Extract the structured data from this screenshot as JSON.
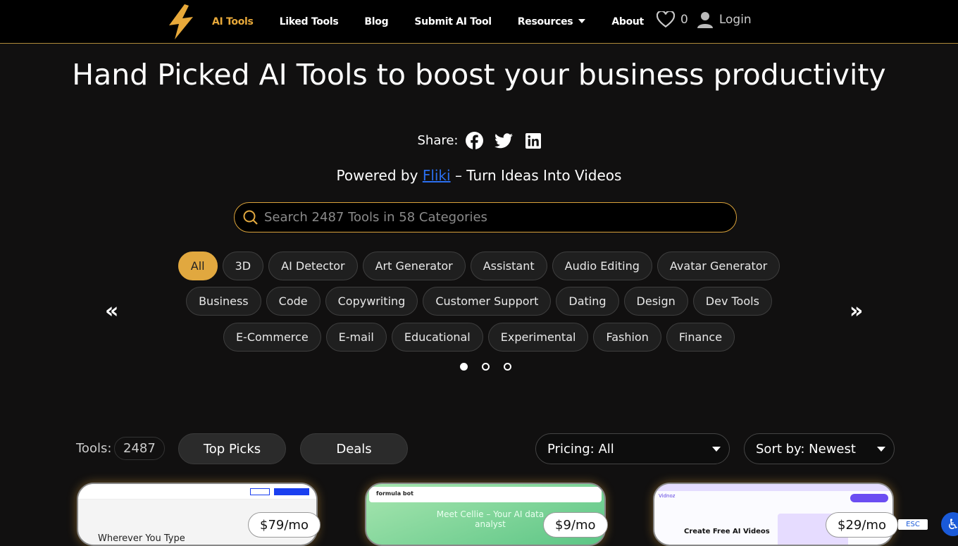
{
  "nav": {
    "links": [
      "AI Tools",
      "Liked Tools",
      "Blog",
      "Submit AI Tool",
      "Resources",
      "About"
    ],
    "liked_count": "0",
    "login": "Login"
  },
  "hero": {
    "title": "Hand Picked AI Tools to boost your business productivity",
    "share": "Share:",
    "powered_prefix": "Powered by",
    "powered_link": "Fliki",
    "powered_suffix": "– Turn Ideas Into Videos"
  },
  "search": {
    "placeholder": "Search 2487 Tools in 58 Categories"
  },
  "categories": [
    [
      "All",
      "3D",
      "AI Detector",
      "Art Generator",
      "Assistant",
      "Audio Editing",
      "Avatar Generator"
    ],
    [
      "Business",
      "Code",
      "Copywriting",
      "Customer Support",
      "Dating",
      "Design",
      "Dev Tools"
    ],
    [
      "E-Commerce",
      "E-mail",
      "Educational",
      "Experimental",
      "Fashion",
      "Finance"
    ]
  ],
  "carousel": {
    "prev": "«",
    "next": "»",
    "pages": 3,
    "current": 1
  },
  "toolbar": {
    "label": "Tools:",
    "count": "2487",
    "top_picks": "Top Picks",
    "deals": "Deals",
    "pricing": "Pricing: All",
    "sort": "Sort by: Newest"
  },
  "cards": [
    {
      "price": "$79/mo",
      "headline": "Wherever You Type"
    },
    {
      "price": "$9/mo",
      "brand": "formula bot",
      "headline": "Meet Cellie – Your AI data analyst"
    },
    {
      "price": "$29/mo",
      "brand": "Vidnoz",
      "headline": "Create Free AI Videos"
    }
  ],
  "widgets": {
    "esc": "ESC"
  },
  "colors": {
    "accent": "#e1a83f",
    "link": "#2b6ff0"
  }
}
